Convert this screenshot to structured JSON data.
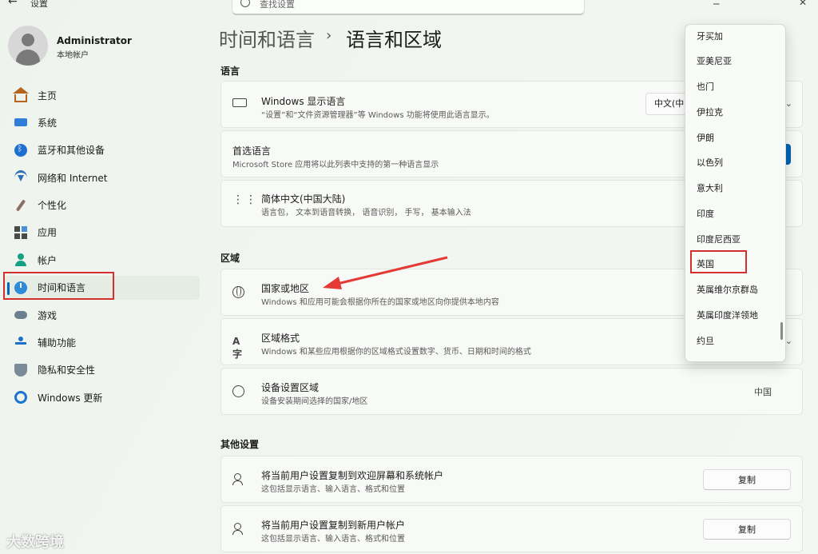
{
  "app": {
    "title": "设置",
    "back_glyph": "←",
    "min_glyph": "─",
    "close_glyph": "✕"
  },
  "search": {
    "placeholder": "查找设置"
  },
  "user": {
    "name": "Administrator",
    "subtitle": "本地帐户"
  },
  "sidebar": {
    "items": [
      {
        "label": "主页",
        "icon": "home-icon"
      },
      {
        "label": "系统",
        "icon": "system-icon"
      },
      {
        "label": "蓝牙和其他设备",
        "icon": "bluetooth-icon"
      },
      {
        "label": "网络和 Internet",
        "icon": "wifi-icon"
      },
      {
        "label": "个性化",
        "icon": "brush-icon"
      },
      {
        "label": "应用",
        "icon": "apps-icon"
      },
      {
        "label": "帐户",
        "icon": "account-icon"
      },
      {
        "label": "时间和语言",
        "icon": "time-language-icon",
        "active": true
      },
      {
        "label": "游戏",
        "icon": "gamepad-icon"
      },
      {
        "label": "辅助功能",
        "icon": "accessibility-icon"
      },
      {
        "label": "隐私和安全性",
        "icon": "shield-icon"
      },
      {
        "label": "Windows 更新",
        "icon": "update-icon"
      }
    ]
  },
  "breadcrumb": {
    "parent": "时间和语言",
    "separator": "›",
    "current": "语言和区域"
  },
  "sections": {
    "language": "语言",
    "region": "区域",
    "other": "其他设置"
  },
  "cards": {
    "display_lang": {
      "title": "Windows 显示语言",
      "subtitle": "“设置”和“文件资源管理器”等 Windows 功能将使用此语言显示。",
      "value": "中文(中"
    },
    "preferred_lang": {
      "title": "首选语言",
      "subtitle": "Microsoft Store 应用将以此列表中支持的第一种语言显示"
    },
    "zh_cn": {
      "title": "简体中文(中国大陆)",
      "subtitle": "语言包， 文本到语音转换， 语音识别， 手写， 基本输入法"
    },
    "country": {
      "title": "国家或地区",
      "subtitle": "Windows 和应用可能会根据你所在的国家或地区向你提供本地内容"
    },
    "region_format": {
      "title": "区域格式",
      "subtitle": "Windows 和某些应用根据你的区域格式设置数字、货币、日期和时间的格式"
    },
    "device_region": {
      "title": "设备设置区域",
      "subtitle": "设备安装期间选择的国家/地区",
      "value": "中国"
    },
    "copy_welcome": {
      "title": "将当前用户设置复制到欢迎屏幕和系统帐户",
      "subtitle": "这包括显示语言、输入语言、格式和位置",
      "button": "复制"
    },
    "copy_new": {
      "title": "将当前用户设置复制到新用户帐户",
      "subtitle": "这包括显示语言、输入语言、格式和位置",
      "button": "复制"
    }
  },
  "country_dropdown": {
    "options": [
      "牙买加",
      "亚美尼亚",
      "也门",
      "伊拉克",
      "伊朗",
      "以色列",
      "意大利",
      "印度",
      "印度尼西亚",
      "英国",
      "英属维尔京群岛",
      "英属印度洋领地",
      "约旦"
    ],
    "highlighted": "英国"
  },
  "watermark": "大数跨境",
  "colors": {
    "accent": "#0067c0",
    "highlight_box": "#d32f2f",
    "arrow": "#e53935"
  }
}
